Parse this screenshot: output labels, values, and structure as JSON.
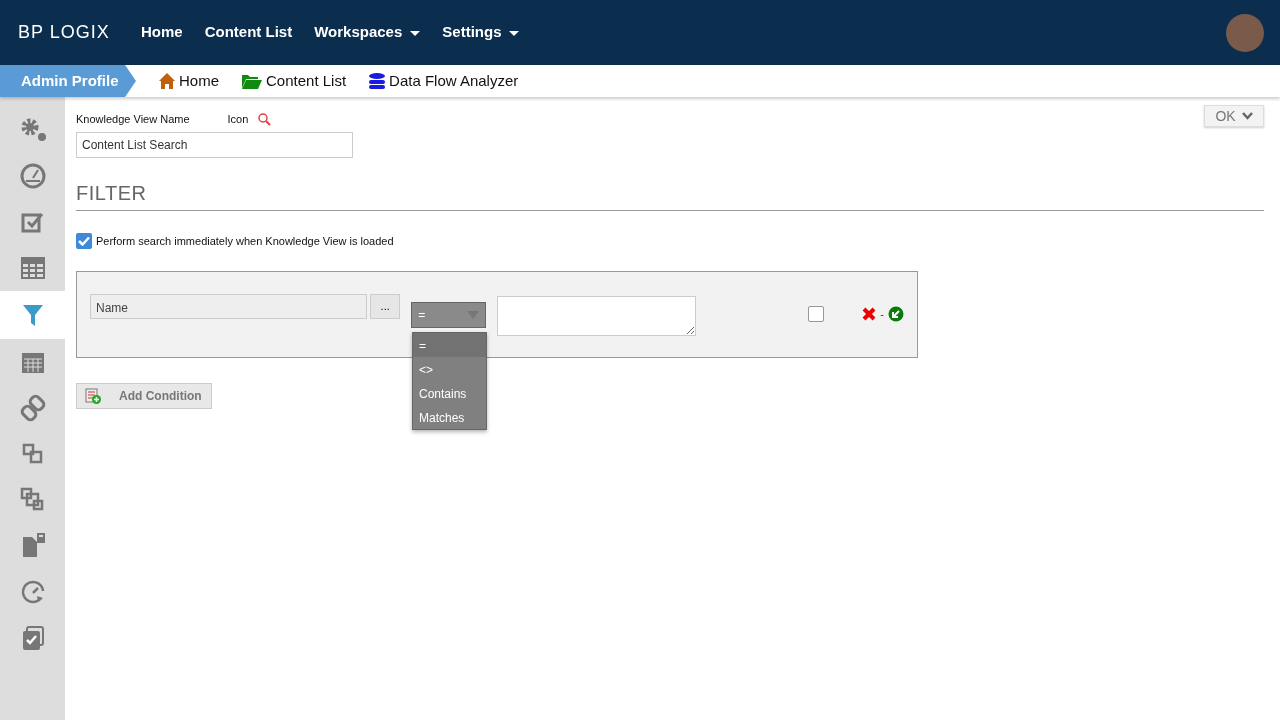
{
  "logo_text": "BP LOGIX",
  "nav": [
    {
      "label": "Home",
      "dropdown": false
    },
    {
      "label": "Content List",
      "dropdown": false
    },
    {
      "label": "Workspaces",
      "dropdown": true
    },
    {
      "label": "Settings",
      "dropdown": true
    }
  ],
  "breadcrumb": {
    "profile": "Admin Profile",
    "links": [
      {
        "label": "Home",
        "kind": "home"
      },
      {
        "label": "Content List",
        "kind": "folder"
      },
      {
        "label": "Data Flow Analyzer",
        "kind": "database"
      }
    ]
  },
  "sidebar": {
    "items": [
      {
        "kind": "gears",
        "selected": false
      },
      {
        "kind": "gauge",
        "selected": false
      },
      {
        "kind": "checkbox",
        "selected": false
      },
      {
        "kind": "table",
        "selected": false
      },
      {
        "kind": "filter",
        "selected": true
      },
      {
        "kind": "calendar",
        "selected": false
      },
      {
        "kind": "link",
        "selected": false
      },
      {
        "kind": "squares",
        "selected": false
      },
      {
        "kind": "squares2",
        "selected": false
      },
      {
        "kind": "file-lock",
        "selected": false
      },
      {
        "kind": "clock",
        "selected": false
      },
      {
        "kind": "check-stack",
        "selected": false
      }
    ]
  },
  "ok_button": "OK",
  "form": {
    "name_label": "Knowledge View Name",
    "icon_label": "Icon",
    "name_value": "Content List Search",
    "section_title": "FILTER",
    "auto_search": {
      "label": "Perform search immediately when Knowledge View is loaded",
      "checked": true
    }
  },
  "condition": {
    "field_value": "Name",
    "browse_button": "...",
    "operator": {
      "value": "=",
      "expanded": true,
      "options": [
        {
          "label": "=",
          "selected": true
        },
        {
          "label": "<>",
          "selected": false
        },
        {
          "label": "Contains",
          "selected": false
        },
        {
          "label": "Matches",
          "selected": false
        }
      ]
    },
    "checkbox_checked": false,
    "separator": "-"
  },
  "add_condition": "Add Condition"
}
